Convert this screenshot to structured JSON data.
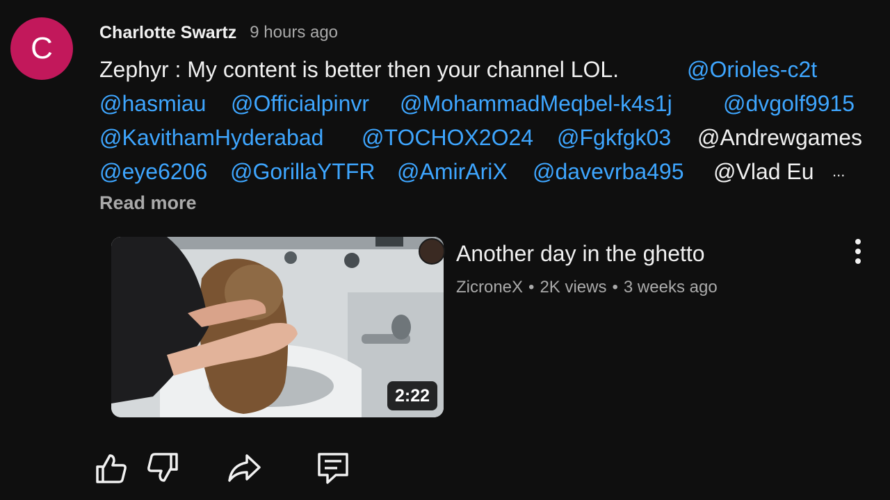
{
  "comment": {
    "avatar_letter": "C",
    "avatar_color": "#c2185b",
    "author": "Charlotte Swartz",
    "time": "9 hours ago",
    "lines": [
      [
        {
          "text": "Zephyr : My content is better then your channel LOL.",
          "mention": false
        },
        {
          "text": "@Orioles-c2t",
          "mention": true
        }
      ],
      [
        {
          "text": "@hasmiau",
          "mention": true
        },
        {
          "text": "@Officialpinvr",
          "mention": true
        },
        {
          "text": "@MohammadMeqbel-k4s1j",
          "mention": true
        },
        {
          "text": "@dvgolf9915",
          "mention": true
        }
      ],
      [
        {
          "text": "@KavithamHyderabad",
          "mention": true
        },
        {
          "text": "@TOCHOX2O24",
          "mention": true
        },
        {
          "text": "@Fgkfgk03",
          "mention": true
        },
        {
          "text": "@Andrewgames",
          "mention": false
        }
      ],
      [
        {
          "text": "@eye6206",
          "mention": true
        },
        {
          "text": "@GorillaYTFR",
          "mention": true
        },
        {
          "text": "@AmirAriX",
          "mention": true
        },
        {
          "text": "@davevrba495",
          "mention": true
        },
        {
          "text": "@Vlad Eu",
          "mention": false
        }
      ]
    ],
    "ellipsis": "...",
    "read_more": "Read more"
  },
  "video": {
    "title": "Another day in the ghetto",
    "channel": "ZicroneX",
    "views": "2K views",
    "age": "3 weeks ago",
    "separator": "•",
    "duration": "2:22"
  },
  "actions": [
    {
      "name": "like",
      "icon": "thumbs-up-icon"
    },
    {
      "name": "dislike",
      "icon": "thumbs-down-icon"
    },
    {
      "name": "share",
      "icon": "share-icon"
    },
    {
      "name": "reply",
      "icon": "comment-icon"
    }
  ],
  "colors": {
    "background": "#0f0f0f",
    "text": "#f1f1f1",
    "secondary_text": "#aaaaaa",
    "mention": "#3ea6ff"
  }
}
